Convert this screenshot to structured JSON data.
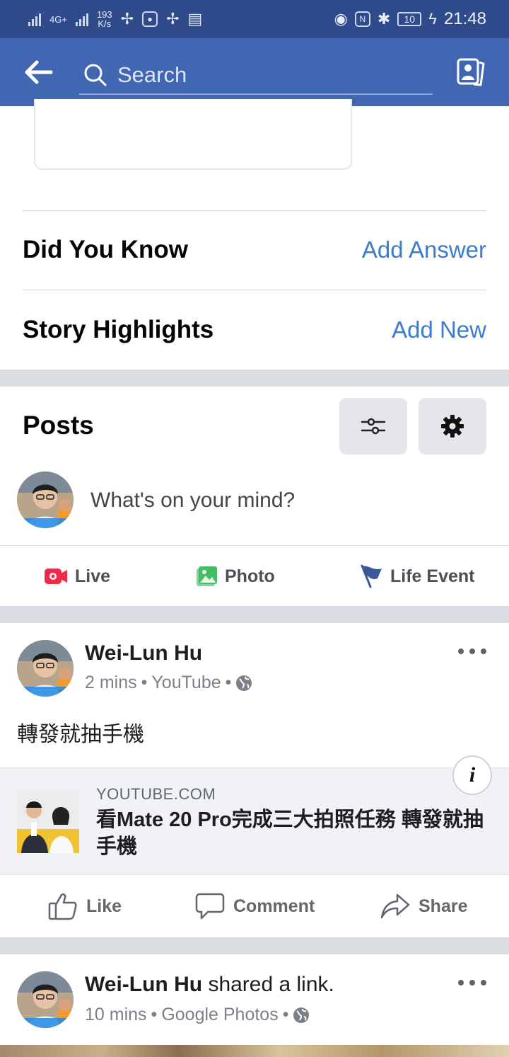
{
  "status_bar": {
    "network": "4G+",
    "speed_value": "193",
    "speed_unit": "K/s",
    "battery": "10",
    "time": "21:48"
  },
  "app_bar": {
    "back_icon": "arrow-left-icon",
    "search_placeholder": "Search",
    "profile_icon": "profile-switch-icon"
  },
  "sections": {
    "did_you_know": {
      "title": "Did You Know",
      "action": "Add Answer"
    },
    "story_highlights": {
      "title": "Story Highlights",
      "action": "Add New"
    }
  },
  "posts_header": {
    "title": "Posts",
    "filter_icon": "sliders-icon",
    "settings_icon": "gear-icon"
  },
  "composer": {
    "placeholder": "What's on your mind?"
  },
  "composer_actions": [
    {
      "label": "Live",
      "icon": "live-video-icon",
      "color": "#f02849"
    },
    {
      "label": "Photo",
      "icon": "photo-icon",
      "color": "#45bd62"
    },
    {
      "label": "Life Event",
      "icon": "flag-icon",
      "color": "#3b5998"
    }
  ],
  "post1": {
    "author": "Wei-Lun Hu",
    "time": "2 mins",
    "source": "YouTube",
    "privacy_icon": "globe-icon",
    "text": "轉發就抽手機",
    "link": {
      "domain": "YOUTUBE.COM",
      "title": "看Mate 20 Pro完成三大拍照任務 轉發就抽手機",
      "info_label": "i"
    },
    "actions": [
      {
        "label": "Like",
        "icon": "thumbs-up-icon"
      },
      {
        "label": "Comment",
        "icon": "comment-icon"
      },
      {
        "label": "Share",
        "icon": "share-icon"
      }
    ]
  },
  "post2": {
    "author": "Wei-Lun Hu",
    "activity": "shared a link.",
    "time": "10 mins",
    "source": "Google Photos",
    "privacy_icon": "globe-icon"
  },
  "colors": {
    "status_bar": "#2f4b8c",
    "app_bar": "#4267b2",
    "link_blue": "#3b7bd0",
    "band_gray": "#dadde1"
  }
}
